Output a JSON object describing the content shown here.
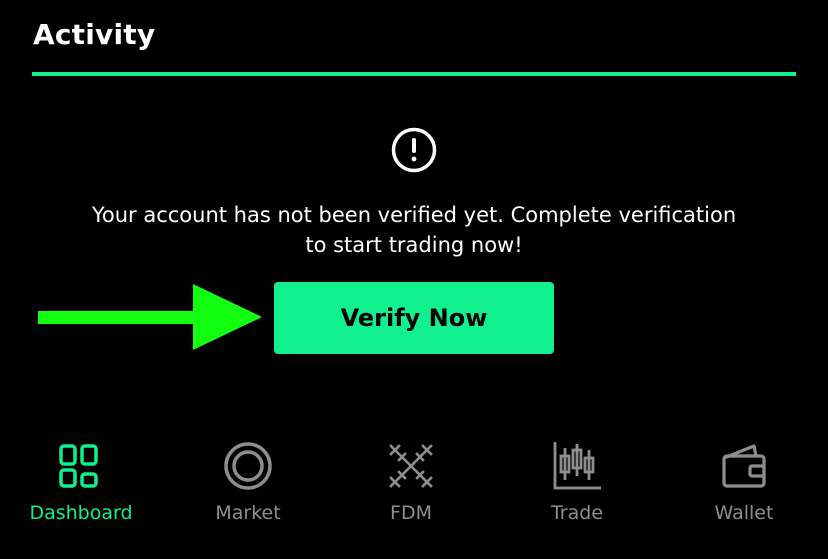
{
  "header": {
    "title": "Activity"
  },
  "alert": {
    "icon": "exclamation-circle-icon",
    "message": "Your account has not been verified yet. Complete verification to start trading now!"
  },
  "verify_button": {
    "label": "Verify Now"
  },
  "annotation": {
    "icon": "arrow-right-icon",
    "color": "#12ff12"
  },
  "bottom_nav": {
    "items": [
      {
        "label": "Dashboard",
        "icon": "dashboard-icon",
        "active": true
      },
      {
        "label": "Market",
        "icon": "market-icon",
        "active": false
      },
      {
        "label": "FDM",
        "icon": "fdm-icon",
        "active": false
      },
      {
        "label": "Trade",
        "icon": "trade-icon",
        "active": false
      },
      {
        "label": "Wallet",
        "icon": "wallet-icon",
        "active": false
      }
    ]
  },
  "colors": {
    "accent": "#10f08e",
    "background": "#000000",
    "inactive": "#8e8e8e"
  }
}
